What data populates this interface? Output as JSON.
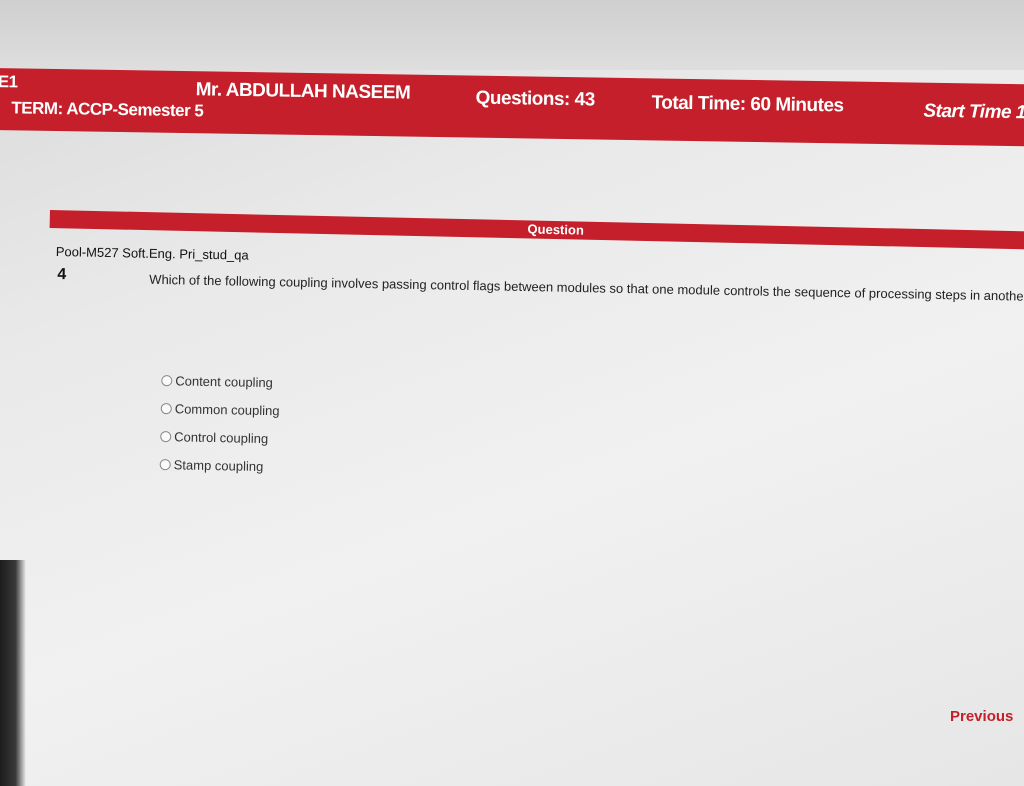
{
  "header": {
    "code_fragment": "E1",
    "term": "TERM: ACCP-Semester 5",
    "student_name": "Mr. ABDULLAH NASEEM",
    "questions": "Questions:  43",
    "total_time": "Total Time:  60 Minutes",
    "start_time": "Start Time  1"
  },
  "question_panel": {
    "title": "Question",
    "pool": "Pool-M527 Soft.Eng. Pri_stud_qa",
    "number": "4",
    "text": "Which of the following coupling involves passing control flags between modules so that one module controls the sequence of processing steps in another module?",
    "options": [
      {
        "label": "Content coupling"
      },
      {
        "label": "Common coupling"
      },
      {
        "label": "Control coupling"
      },
      {
        "label": "Stamp coupling"
      }
    ]
  },
  "nav": {
    "previous_label": "Previous"
  },
  "colors": {
    "accent": "#c41f2a"
  }
}
